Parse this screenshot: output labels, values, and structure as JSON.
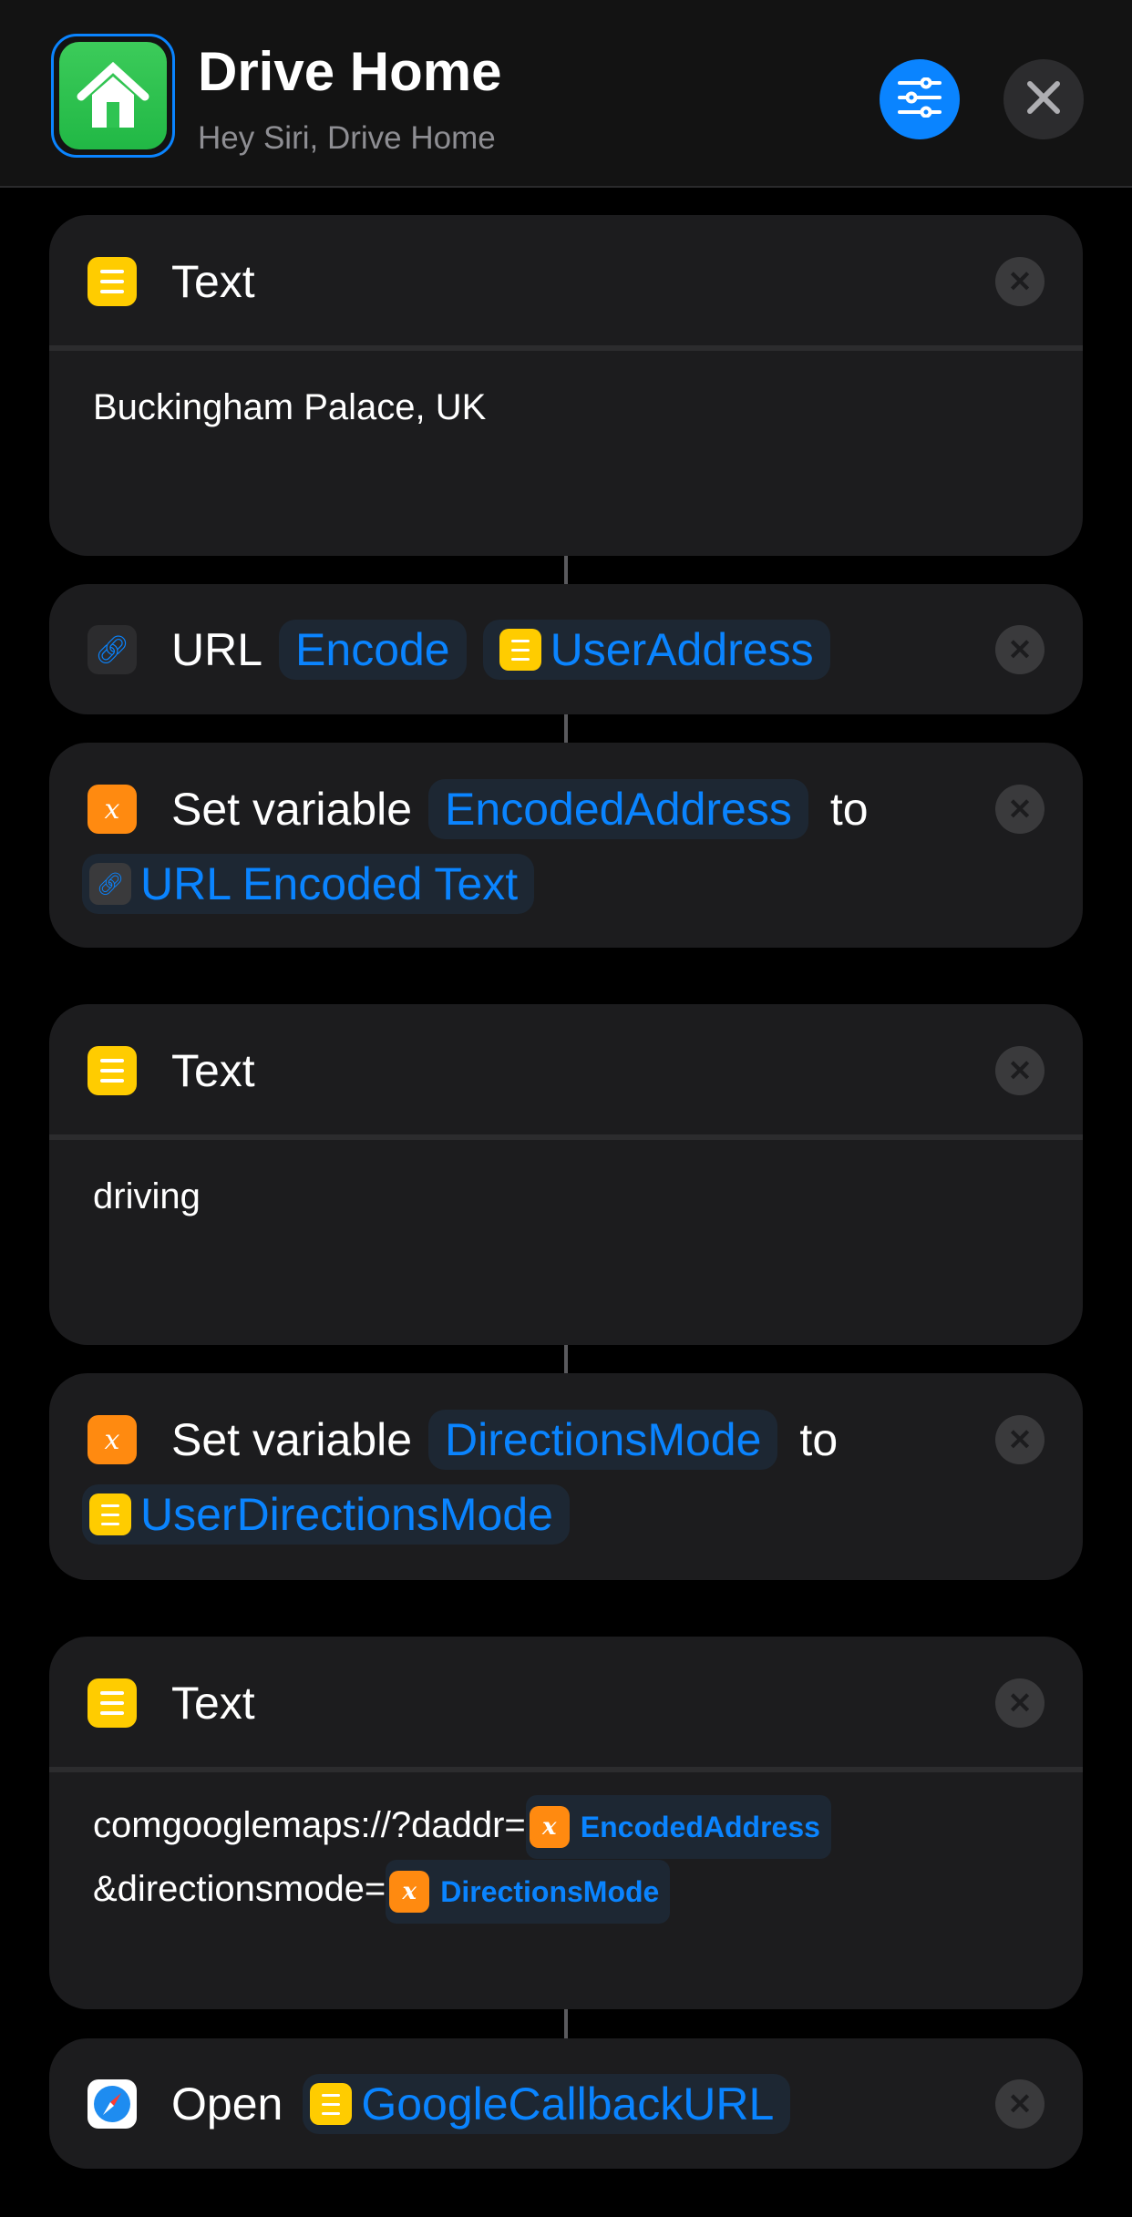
{
  "header": {
    "title": "Drive Home",
    "subtitle": "Hey Siri, Drive Home",
    "app_icon": "house-icon",
    "settings_icon": "sliders-icon",
    "close_icon": "close-icon"
  },
  "colors": {
    "accent": "#0a84ff",
    "text_action": "#ffcc00",
    "variable_action": "#ff8a10",
    "app_icon": "#2fc452"
  },
  "actions": [
    {
      "type": "Text",
      "title": "Text",
      "body": "Buckingham Palace, UK"
    },
    {
      "type": "URL",
      "title": "URL",
      "mode": "Encode",
      "input": "UserAddress"
    },
    {
      "type": "SetVariable",
      "title": "Set variable",
      "variable": "EncodedAddress",
      "to": "to",
      "value": "URL Encoded Text"
    },
    {
      "type": "Text",
      "title": "Text",
      "body": "driving"
    },
    {
      "type": "SetVariable",
      "title": "Set variable",
      "variable": "DirectionsMode",
      "to": "to",
      "value": "UserDirectionsMode"
    },
    {
      "type": "Text",
      "title": "Text",
      "body_line1": "comgooglemaps://?daddr=",
      "token1": "EncodedAddress",
      "body_line2": "&directionsmode=",
      "token2": "DirectionsMode"
    },
    {
      "type": "Open",
      "title": "Open",
      "input": "GoogleCallbackURL"
    }
  ]
}
